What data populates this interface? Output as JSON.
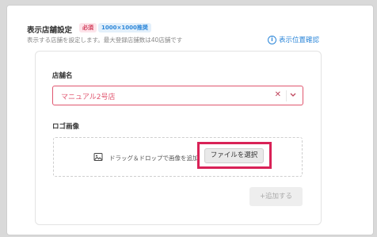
{
  "header": {
    "title": "表示店舗設定",
    "required_badge": "必須",
    "size_badge": "1000×1000推奨",
    "subtitle": "表示する店舗を設定します。最大登録店舗数は40店舗です",
    "location_link": "表示位置確認"
  },
  "store_field": {
    "label": "店舗名",
    "value": "マニュアル2号店"
  },
  "logo_field": {
    "label": "ロゴ画像",
    "drop_text": "ドラッグ＆ドロップで画像を追加",
    "file_button": "ファイルを選択"
  },
  "add_button": "+追加する",
  "colors": {
    "accent_red": "#e0566f",
    "link_blue": "#2b86d9",
    "highlight": "#d92257"
  }
}
